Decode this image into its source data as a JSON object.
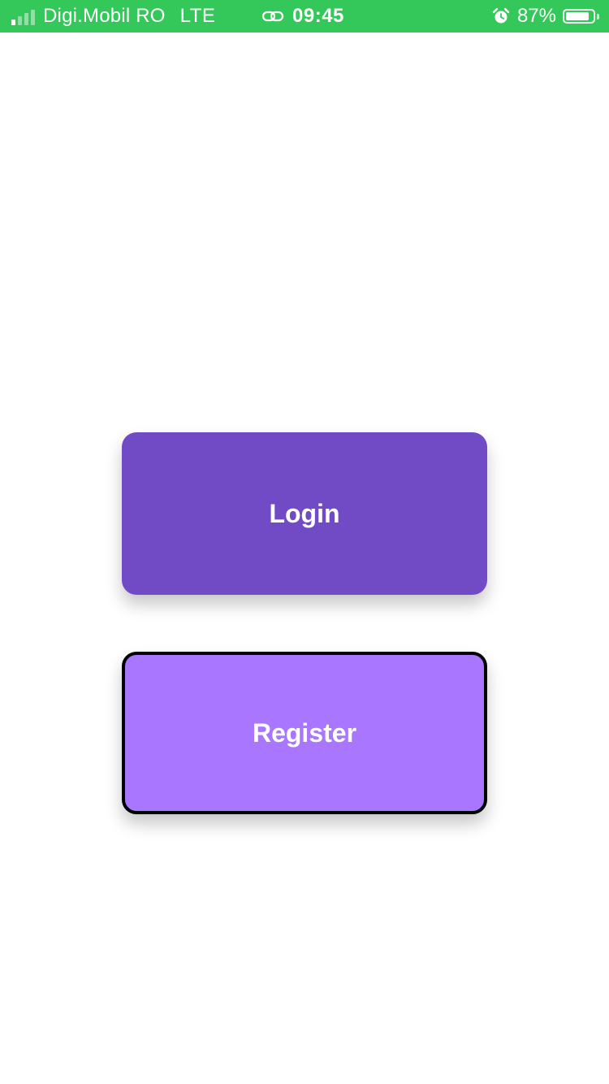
{
  "status_bar": {
    "carrier": "Digi.Mobil RO",
    "network": "LTE",
    "time": "09:45",
    "battery_percent_label": "87%",
    "battery_level": 0.87,
    "signal_bars_active": 1,
    "signal_bars_total": 4,
    "icons": [
      "signal-icon",
      "link-icon",
      "alarm-icon",
      "battery-icon"
    ],
    "color": "#34c759"
  },
  "actions": {
    "login_label": "Login",
    "register_label": "Register",
    "login_color": "#714bc6",
    "register_color": "#a976ff",
    "register_border_color": "#000000"
  }
}
